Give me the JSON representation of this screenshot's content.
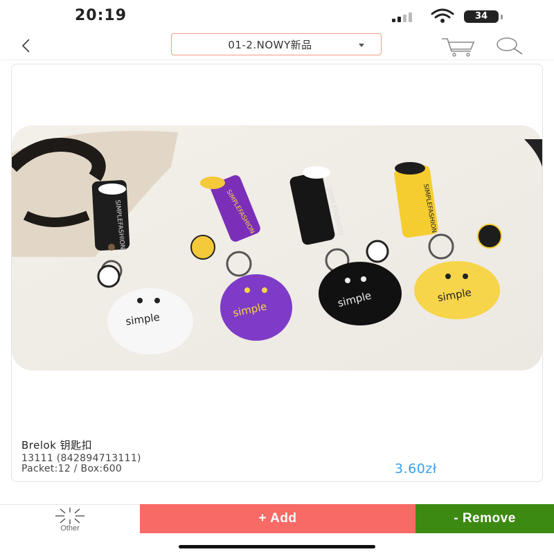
{
  "status_bar": {
    "time": "20:19",
    "battery": "34"
  },
  "nav": {
    "back_icon": "chevron-left-icon",
    "category": "01-2.NOWY新品",
    "cart_icon": "cart-icon",
    "search_icon": "search-icon"
  },
  "product": {
    "name": "Brelok 钥匙扣",
    "code": "13111 (842894713111)",
    "packet": "Packet:12 / Box:600",
    "price": "3.60zł",
    "image": "keychain-photo"
  },
  "actions": {
    "other_label": "Other",
    "add_label": "+ Add",
    "remove_label": "- Remove"
  },
  "colors": {
    "accent_blue": "#3aa0e6",
    "add_red": "#f76a66",
    "remove_green": "#3d8a13",
    "select_border": "#f29b86"
  }
}
